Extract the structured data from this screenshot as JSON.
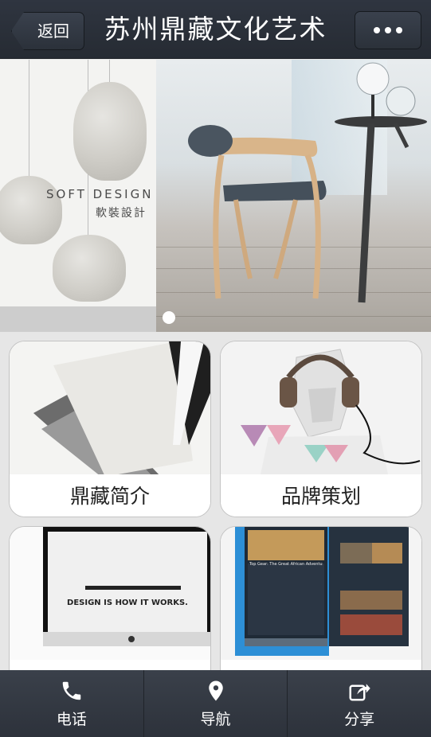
{
  "header": {
    "back_label": "返回",
    "title": "苏州鼎藏文化艺术",
    "more_icon": "more-dots-icon"
  },
  "banner": {
    "slide_text_en": "SOFT DESIGN",
    "slide_text_cn": "軟裝設計",
    "slides_total": 2,
    "active_slide": 1
  },
  "tiles": [
    {
      "label": "鼎藏简介",
      "image": "paper-sheets"
    },
    {
      "label": "品牌策划",
      "image": "bust-headphones"
    },
    {
      "label": "",
      "image": "monitor",
      "screen_line1": "DESIGN IS HOW IT WORKS."
    },
    {
      "label": "",
      "image": "tablet-app",
      "app_title": "Top Gear: The Great African Adventure"
    }
  ],
  "bottom_bar": [
    {
      "label": "电话",
      "icon": "phone-icon"
    },
    {
      "label": "导航",
      "icon": "location-pin-icon"
    },
    {
      "label": "分享",
      "icon": "share-icon"
    }
  ],
  "colors": {
    "header_bg": "#2b313a",
    "bar_bg": "#333943",
    "page_bg": "#e6e6e6"
  }
}
